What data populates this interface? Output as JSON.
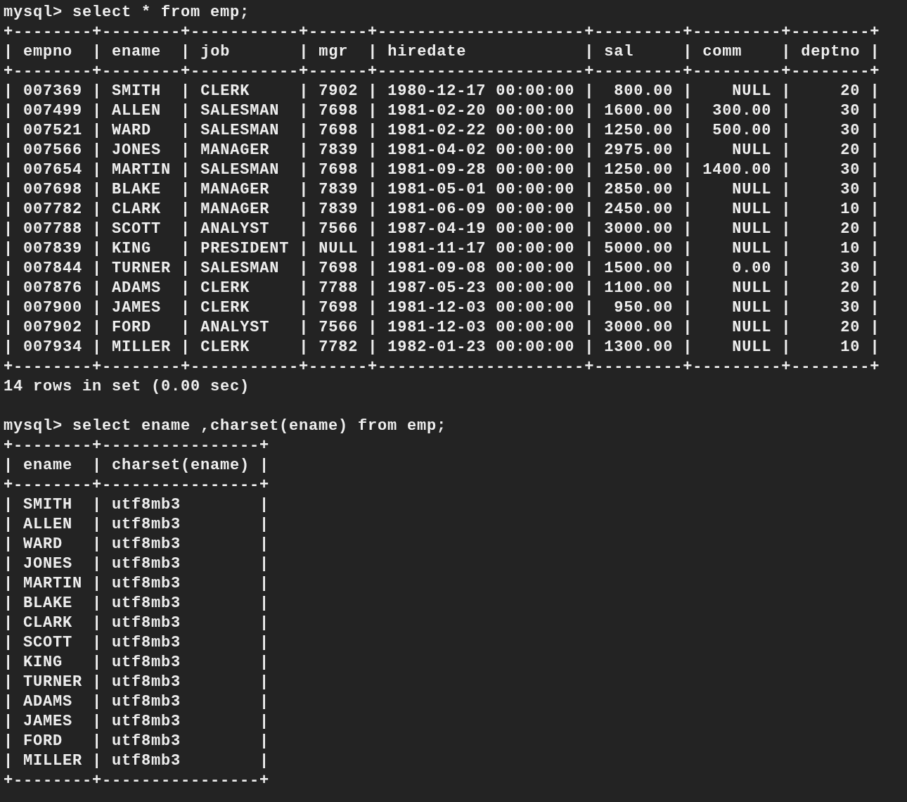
{
  "border": {
    "vertical": "|"
  },
  "sessions": [
    {
      "prompt": "mysql>",
      "command": "select * from emp;",
      "rules": [
        "+--------+--------+-----------+------+---------------------+---------+---------+--------+",
        "+--------+--------+-----------+------+---------------------+---------+---------+--------+",
        "+--------+--------+-----------+------+---------------------+---------+---------+--------+"
      ],
      "columns": [
        {
          "label": "empno"
        },
        {
          "label": "ename"
        },
        {
          "label": "job"
        },
        {
          "label": "mgr"
        },
        {
          "label": "hiredate"
        },
        {
          "label": "sal",
          "right_aligned": true
        },
        {
          "label": "comm",
          "right_aligned": true
        },
        {
          "label": "deptno",
          "right_aligned": true
        }
      ],
      "rows": [
        [
          "007369",
          "SMITH",
          "CLERK",
          "7902",
          "1980-12-17 00:00:00",
          "800.00",
          "NULL",
          "20"
        ],
        [
          "007499",
          "ALLEN",
          "SALESMAN",
          "7698",
          "1981-02-20 00:00:00",
          "1600.00",
          "300.00",
          "30"
        ],
        [
          "007521",
          "WARD",
          "SALESMAN",
          "7698",
          "1981-02-22 00:00:00",
          "1250.00",
          "500.00",
          "30"
        ],
        [
          "007566",
          "JONES",
          "MANAGER",
          "7839",
          "1981-04-02 00:00:00",
          "2975.00",
          "NULL",
          "20"
        ],
        [
          "007654",
          "MARTIN",
          "SALESMAN",
          "7698",
          "1981-09-28 00:00:00",
          "1250.00",
          "1400.00",
          "30"
        ],
        [
          "007698",
          "BLAKE",
          "MANAGER",
          "7839",
          "1981-05-01 00:00:00",
          "2850.00",
          "NULL",
          "30"
        ],
        [
          "007782",
          "CLARK",
          "MANAGER",
          "7839",
          "1981-06-09 00:00:00",
          "2450.00",
          "NULL",
          "10"
        ],
        [
          "007788",
          "SCOTT",
          "ANALYST",
          "7566",
          "1987-04-19 00:00:00",
          "3000.00",
          "NULL",
          "20"
        ],
        [
          "007839",
          "KING",
          "PRESIDENT",
          "NULL",
          "1981-11-17 00:00:00",
          "5000.00",
          "NULL",
          "10"
        ],
        [
          "007844",
          "TURNER",
          "SALESMAN",
          "7698",
          "1981-09-08 00:00:00",
          "1500.00",
          "0.00",
          "30"
        ],
        [
          "007876",
          "ADAMS",
          "CLERK",
          "7788",
          "1987-05-23 00:00:00",
          "1100.00",
          "NULL",
          "20"
        ],
        [
          "007900",
          "JAMES",
          "CLERK",
          "7698",
          "1981-12-03 00:00:00",
          "950.00",
          "NULL",
          "30"
        ],
        [
          "007902",
          "FORD",
          "ANALYST",
          "7566",
          "1981-12-03 00:00:00",
          "3000.00",
          "NULL",
          "20"
        ],
        [
          "007934",
          "MILLER",
          "CLERK",
          "7782",
          "1982-01-23 00:00:00",
          "1300.00",
          "NULL",
          "10"
        ]
      ],
      "result": "14 rows in set (0.00 sec)"
    },
    {
      "prompt": "mysql>",
      "command": "select ename ,charset(ename) from emp;",
      "rules": [
        "+--------+----------------+",
        "+--------+----------------+",
        "+--------+----------------+"
      ],
      "columns": [
        {
          "label": "ename"
        },
        {
          "label": "charset(ename)"
        }
      ],
      "rows": [
        [
          "SMITH",
          "utf8mb3"
        ],
        [
          "ALLEN",
          "utf8mb3"
        ],
        [
          "WARD",
          "utf8mb3"
        ],
        [
          "JONES",
          "utf8mb3"
        ],
        [
          "MARTIN",
          "utf8mb3"
        ],
        [
          "BLAKE",
          "utf8mb3"
        ],
        [
          "CLARK",
          "utf8mb3"
        ],
        [
          "SCOTT",
          "utf8mb3"
        ],
        [
          "KING",
          "utf8mb3"
        ],
        [
          "TURNER",
          "utf8mb3"
        ],
        [
          "ADAMS",
          "utf8mb3"
        ],
        [
          "JAMES",
          "utf8mb3"
        ],
        [
          "FORD",
          "utf8mb3"
        ],
        [
          "MILLER",
          "utf8mb3"
        ]
      ]
    }
  ]
}
